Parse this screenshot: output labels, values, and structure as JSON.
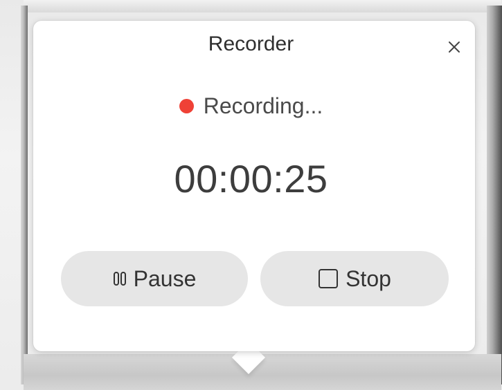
{
  "recorder": {
    "title": "Recorder",
    "status_text": "Recording...",
    "elapsed_time": "00:00:25",
    "pause_label": "Pause",
    "stop_label": "Stop",
    "close_icon": "close-icon",
    "pause_icon": "pause-icon",
    "stop_icon": "stop-square-icon",
    "status_color": "#ef4136"
  }
}
